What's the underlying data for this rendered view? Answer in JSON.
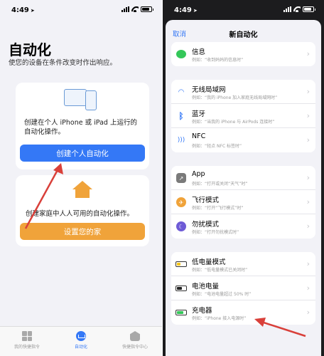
{
  "left": {
    "status": {
      "time": "4:49"
    },
    "title": "自动化",
    "subtitle": "使您的设备在条件改变时作出响应。",
    "personal_card": {
      "description": "创建在个人 iPhone 或 iPad 上运行的自动化操作。",
      "button": "创建个人自动化"
    },
    "home_card": {
      "description": "创建家庭中人人可用的自动化操作。",
      "button": "设置您的家"
    },
    "tabbar": [
      {
        "label": "我的快捷指令"
      },
      {
        "label": "自动化"
      },
      {
        "label": "快捷指令中心"
      }
    ]
  },
  "right": {
    "status": {
      "time": "4:49"
    },
    "cancel": "取消",
    "title": "新自动化",
    "groups": [
      [
        {
          "title": "信息",
          "subtitle": "例如：“收到妈妈的信息时”",
          "icon": "message-icon"
        }
      ],
      [
        {
          "title": "无线局域网",
          "subtitle": "例如：“我的 iPhone 加入家庭无线局域网时”",
          "icon": "wifi-icon"
        },
        {
          "title": "蓝牙",
          "subtitle": "例如：“当我的 iPhone 与 AirPods 连接时”",
          "icon": "bluetooth-icon"
        },
        {
          "title": "NFC",
          "subtitle": "例如：“轻点 NFC 标签时”",
          "icon": "nfc-icon"
        }
      ],
      [
        {
          "title": "App",
          "subtitle": "例如：“打开或关闭“天气”时”",
          "icon": "app-icon"
        },
        {
          "title": "飞行模式",
          "subtitle": "例如：“打开“飞行模式”时”",
          "icon": "airplane-icon"
        },
        {
          "title": "勿扰模式",
          "subtitle": "例如：“打开勿扰模式时”",
          "icon": "moon-icon"
        }
      ],
      [
        {
          "title": "低电量模式",
          "subtitle": "例如：“低电量模式已关闭时”",
          "icon": "low-battery-icon"
        },
        {
          "title": "电池电量",
          "subtitle": "例如：“电池电量超过 50% 时”",
          "icon": "battery-icon"
        },
        {
          "title": "充电器",
          "subtitle": "例如：“iPhone 接入电源时”",
          "icon": "charger-icon"
        }
      ]
    ]
  },
  "colors": {
    "accent": "#3478f6",
    "home": "#f0a33a",
    "arrow": "#d9403a"
  }
}
